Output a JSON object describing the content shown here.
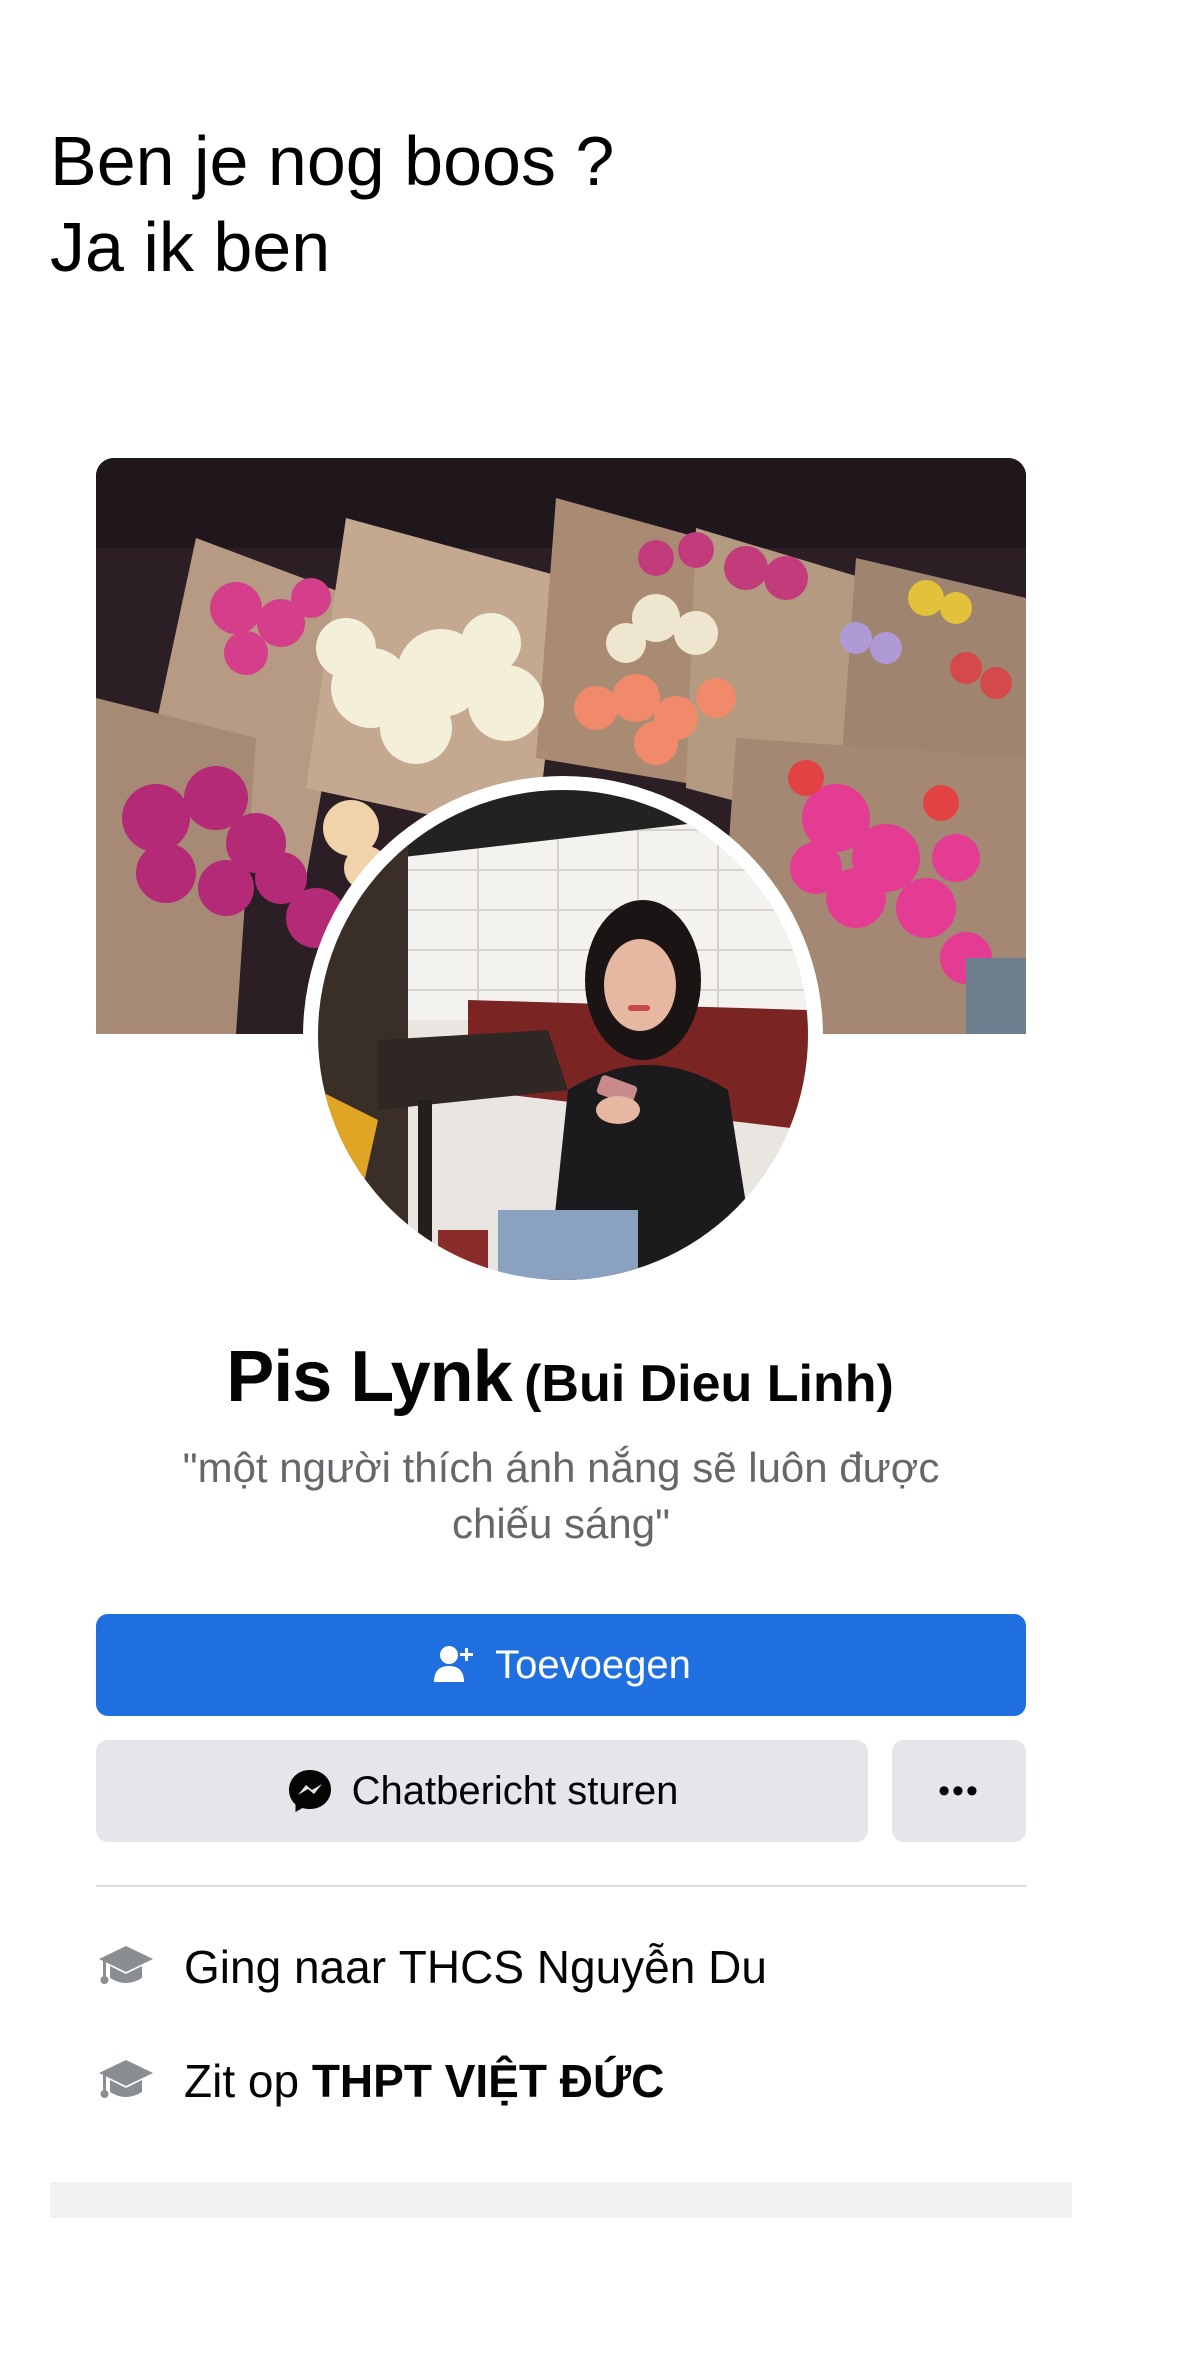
{
  "caption": {
    "line1": "Ben je nog boos ?",
    "line2": "Ja ik ben"
  },
  "profile": {
    "name": "Pis Lynk",
    "alternate_name": "(Bui Dieu Linh)",
    "bio": "\"một người thích ánh nắng sẽ luôn được chiếu sáng\""
  },
  "actions": {
    "add_friend_label": "Toevoegen",
    "add_friend_icon": "add-friend-icon",
    "message_label": "Chatbericht sturen",
    "message_icon": "messenger-icon",
    "more_label": "•••",
    "more_icon": "more-dots-icon"
  },
  "info": [
    {
      "icon": "graduation-cap-icon",
      "prefix": "Ging naar ",
      "value": "THCS Nguyễn Du",
      "value_bold": false
    },
    {
      "icon": "graduation-cap-icon",
      "prefix": "Zit op ",
      "value": "THPT VIỆT ĐỨC",
      "value_bold": true
    }
  ],
  "colors": {
    "primary_button": "#1f6fe0",
    "secondary_button": "#e4e6eb",
    "muted_text": "#65676b"
  }
}
